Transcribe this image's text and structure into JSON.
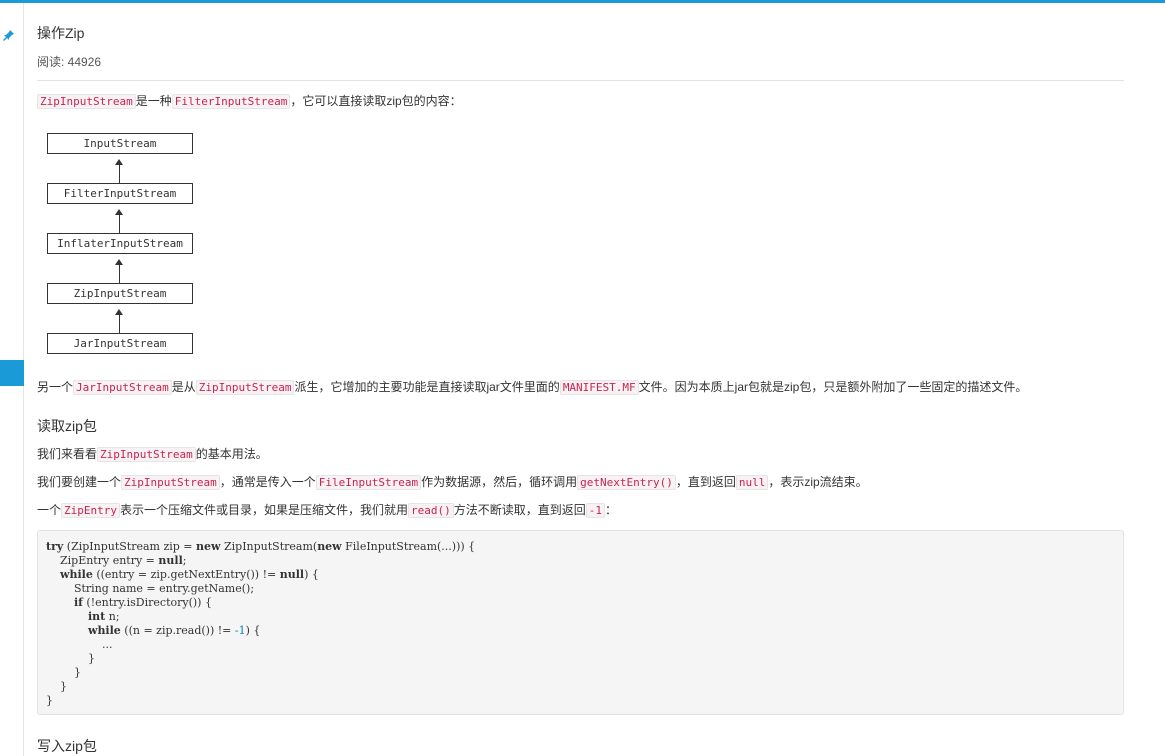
{
  "header": {
    "title": "操作Zip",
    "reads_label": "阅读: 44926"
  },
  "icons": {
    "pin": "pin-icon",
    "accent": "#1a9ad6"
  },
  "intro": {
    "code1": "ZipInputStream",
    "text1": "是一种",
    "code2": "FilterInputStream",
    "text2": "，它可以直接读取zip包的内容："
  },
  "diagram": {
    "boxes": [
      "InputStream",
      "FilterInputStream",
      "InflaterInputStream",
      "ZipInputStream",
      "JarInputStream"
    ]
  },
  "jar_para": {
    "text1": "另一个",
    "code1": "JarInputStream",
    "text2": "是从",
    "code2": "ZipInputStream",
    "text3": "派生，它增加的主要功能是直接读取jar文件里面的",
    "code3": "MANIFEST.MF",
    "text4": "文件。因为本质上jar包就是zip包，只是额外附加了一些固定的描述文件。"
  },
  "section_read": {
    "heading": "读取zip包",
    "p1": {
      "text1": "我们来看看",
      "code1": "ZipInputStream",
      "text2": "的基本用法。"
    },
    "p2": {
      "text1": "我们要创建一个",
      "code1": "ZipInputStream",
      "text2": "，通常是传入一个",
      "code2": "FileInputStream",
      "text3": "作为数据源，然后，循环调用",
      "code3": "getNextEntry()",
      "text4": "，直到返回",
      "code4": "null",
      "text5": "，表示zip流结束。"
    },
    "p3": {
      "text1": "一个",
      "code1": "ZipEntry",
      "text2": "表示一个压缩文件或目录，如果是压缩文件，我们就用",
      "code2": "read()",
      "text3": "方法不断读取，直到返回",
      "code3": "-1",
      "text4": "："
    }
  },
  "code": {
    "l1_kw": "try",
    "l1a": " (ZipInputStream zip = ",
    "l1_kw2": "new",
    "l1b": " ZipInputStream(",
    "l1_kw3": "new",
    "l1c": " FileInputStream(...))) {",
    "l2a": "    ZipEntry entry = ",
    "l2_kw": "null",
    "l2b": ";",
    "l3_kw": "while",
    "l3a": " ((entry = zip.getNextEntry()) != ",
    "l3_kw2": "null",
    "l3b": ") {",
    "l4": "        String name = entry.getName();",
    "l5_kw": "if",
    "l5a": " (!entry.isDirectory()) {",
    "l6_kw": "int",
    "l6a": " n;",
    "l7_kw": "while",
    "l7a": " ((n = zip.read()) != ",
    "l7_num": "-1",
    "l7b": ") {",
    "l8": "                ...",
    "l9": "            }",
    "l10": "        }",
    "l11": "    }",
    "l12": "}"
  },
  "section_write": {
    "heading": "写入zip包"
  }
}
